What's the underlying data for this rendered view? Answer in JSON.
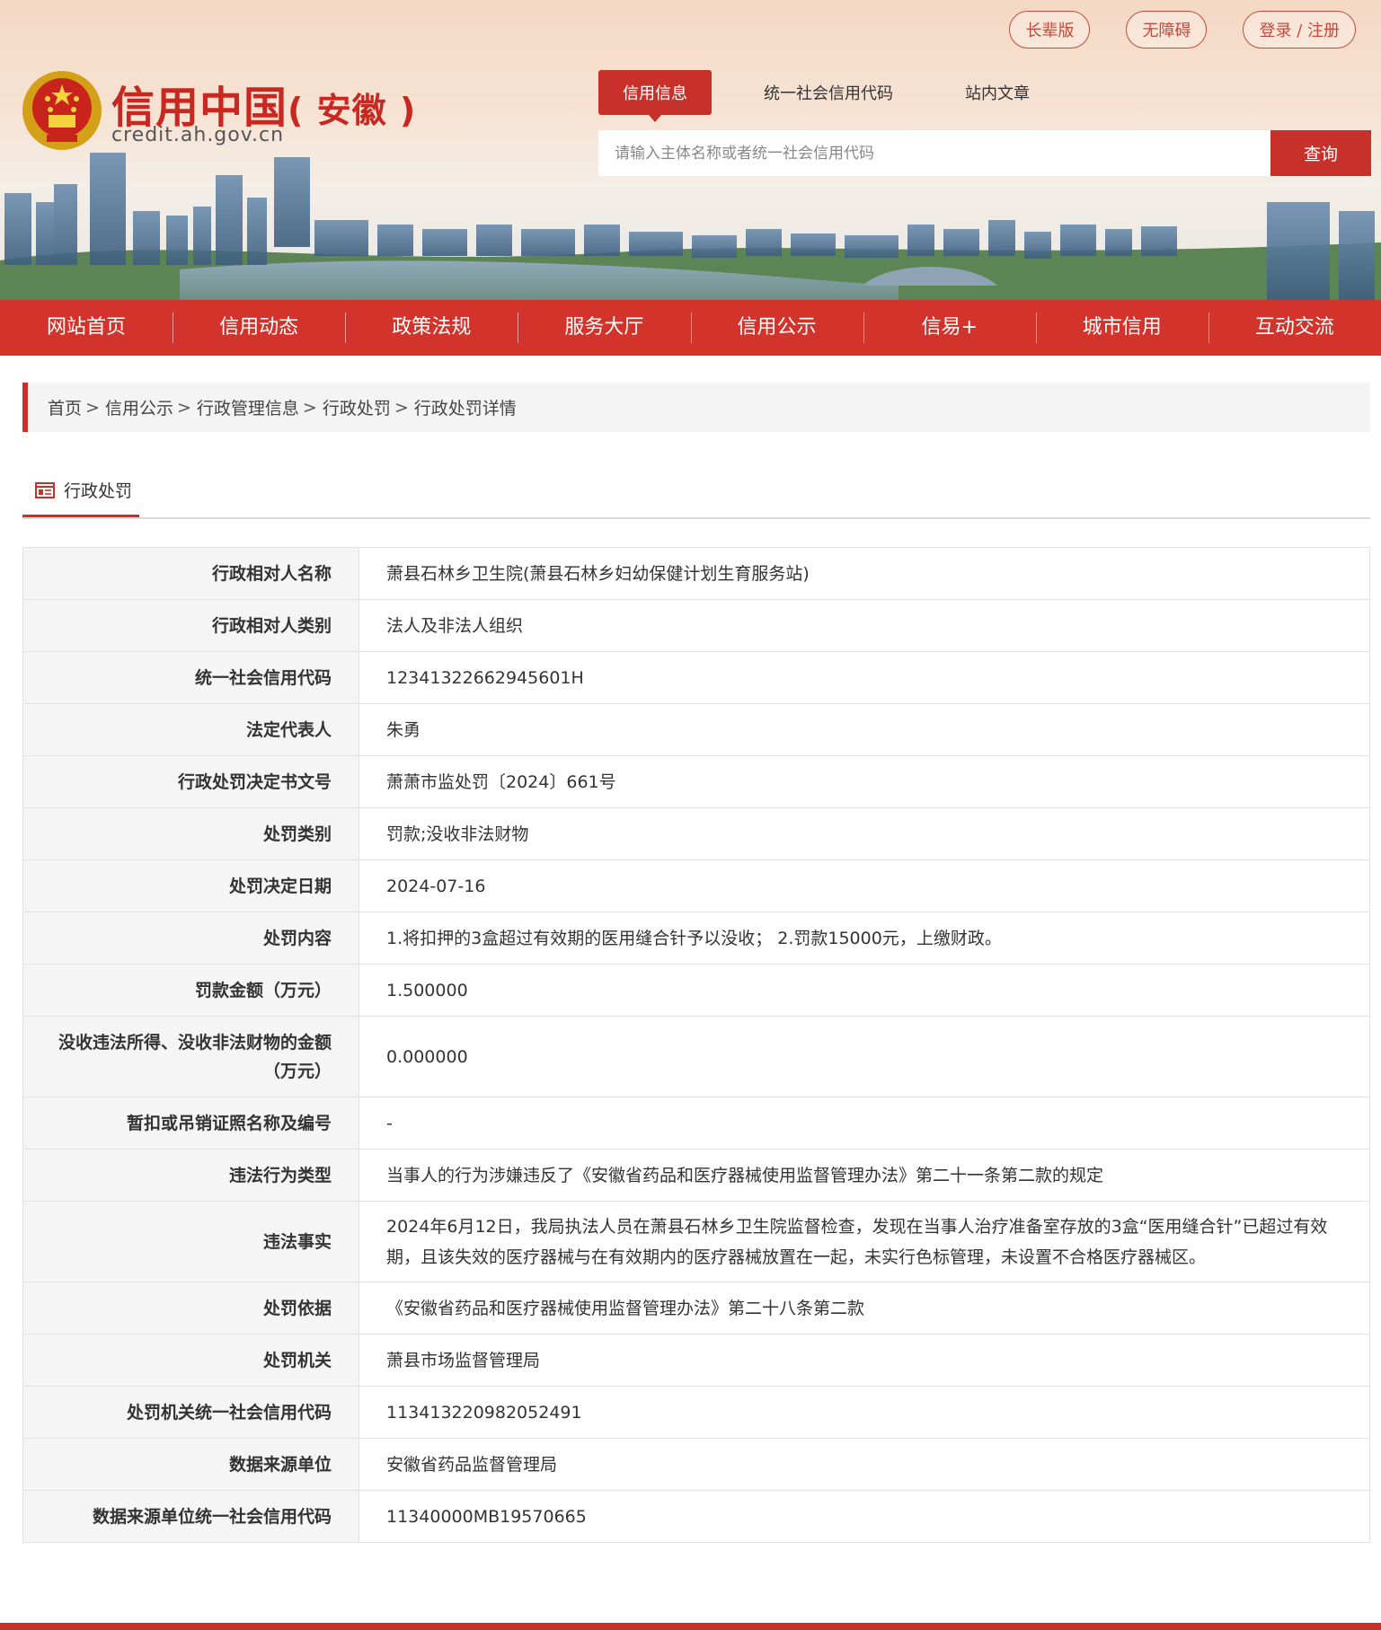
{
  "top_links": [
    "长辈版",
    "无障碍",
    "登录 / 注册"
  ],
  "logo": {
    "title": "信用中国",
    "region": "( 安徽 )",
    "url": "credit.ah.gov.cn"
  },
  "search": {
    "tabs": [
      "信用信息",
      "统一社会信用代码",
      "站内文章"
    ],
    "active_tab": "信用信息",
    "placeholder": "请输入主体名称或者统一社会信用代码",
    "button": "查询"
  },
  "nav": [
    "网站首页",
    "信用动态",
    "政策法规",
    "服务大厅",
    "信用公示",
    "信易+",
    "城市信用",
    "互动交流"
  ],
  "breadcrumb": [
    "首页",
    "信用公示",
    "行政管理信息",
    "行政处罚",
    "行政处罚详情"
  ],
  "section_title": "行政处罚",
  "details": [
    {
      "label": "行政相对人名称",
      "value": "萧县石林乡卫生院(萧县石林乡妇幼保健计划生育服务站)"
    },
    {
      "label": "行政相对人类别",
      "value": "法人及非法人组织"
    },
    {
      "label": "统一社会信用代码",
      "value": "12341322662945601H"
    },
    {
      "label": "法定代表人",
      "value": "朱勇"
    },
    {
      "label": "行政处罚决定书文号",
      "value": "萧萧市监处罚〔2024〕661号"
    },
    {
      "label": "处罚类别",
      "value": "罚款;没收非法财物"
    },
    {
      "label": "处罚决定日期",
      "value": "2024-07-16"
    },
    {
      "label": "处罚内容",
      "value": "1.将扣押的3盒超过有效期的医用缝合针予以没收； 2.罚款15000元，上缴财政。"
    },
    {
      "label": "罚款金额（万元）",
      "value": "1.500000"
    },
    {
      "label": "没收违法所得、没收非法财物的金额（万元）",
      "value": "0.000000"
    },
    {
      "label": "暂扣或吊销证照名称及编号",
      "value": "-"
    },
    {
      "label": "违法行为类型",
      "value": "当事人的行为涉嫌违反了《安徽省药品和医疗器械使用监督管理办法》第二十一条第二款的规定"
    },
    {
      "label": "违法事实",
      "value": "2024年6月12日，我局执法人员在萧县石林乡卫生院监督检查，发现在当事人治疗准备室存放的3盒“医用缝合针”已超过有效期，且该失效的医疗器械与在有效期内的医疗器械放置在一起，未实行色标管理，未设置不合格医疗器械区。"
    },
    {
      "label": "处罚依据",
      "value": "《安徽省药品和医疗器械使用监督管理办法》第二十八条第二款"
    },
    {
      "label": "处罚机关",
      "value": "萧县市场监督管理局"
    },
    {
      "label": "处罚机关统一社会信用代码",
      "value": "11341322098205249​1"
    },
    {
      "label": "数据来源单位",
      "value": "安徽省药品监督管理局"
    },
    {
      "label": "数据来源单位统一社会信用代码",
      "value": "11340000MB19570665"
    }
  ],
  "colors": {
    "brand": "#c8302a",
    "nav": "#d2342c",
    "label_bg": "#f5f5f5"
  },
  "icons": [
    "national-emblem-icon",
    "section-list-icon"
  ]
}
